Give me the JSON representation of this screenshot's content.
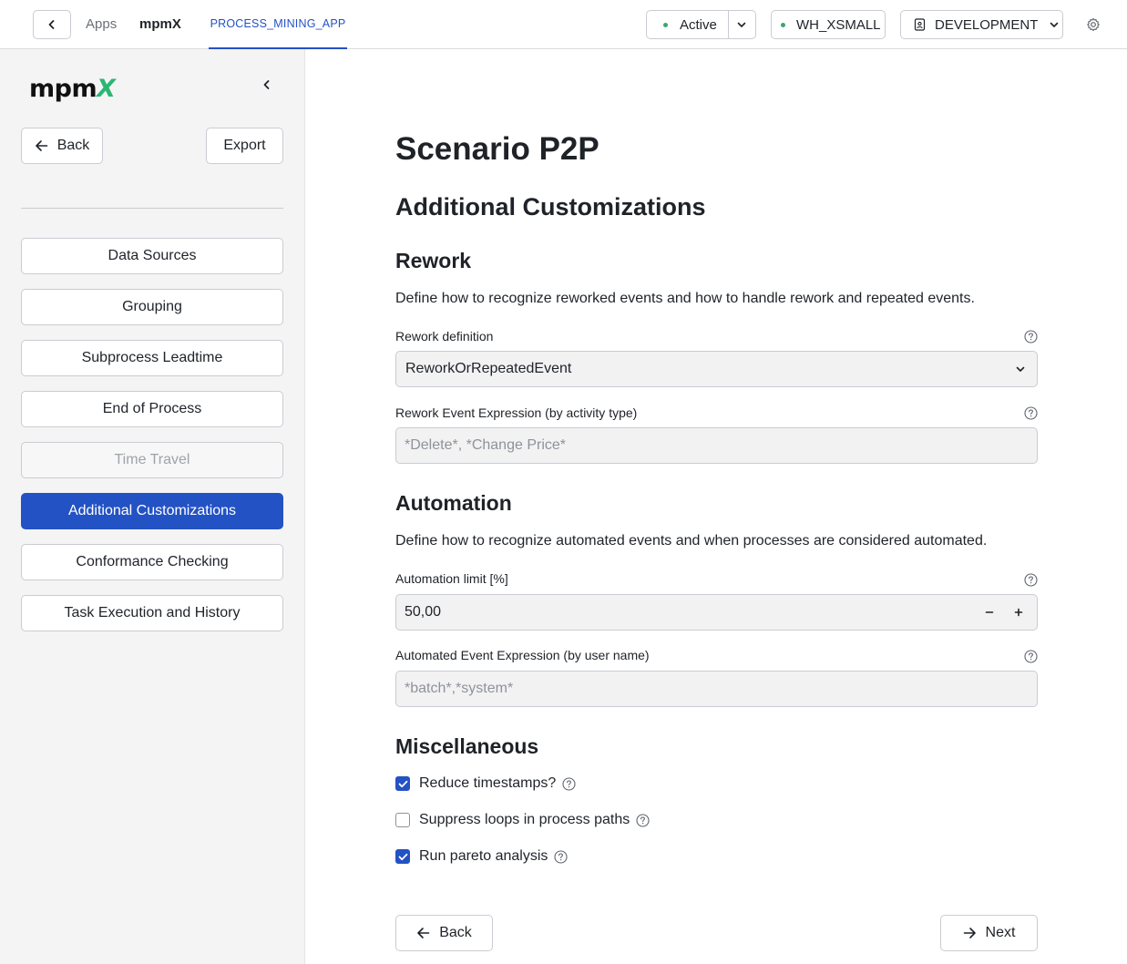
{
  "topbar": {
    "breadcrumb": [
      "Apps",
      "mpmX"
    ],
    "app_tab": "PROCESS_MINING_APP",
    "status": "Active",
    "warehouse": "WH_XSMALL",
    "environment": "DEVELOPMENT"
  },
  "sidebar": {
    "logo_main": "mpm",
    "logo_accent": "X",
    "back_label": "Back",
    "export_label": "Export",
    "nav": [
      {
        "label": "Data Sources",
        "state": "default"
      },
      {
        "label": "Grouping",
        "state": "default"
      },
      {
        "label": "Subprocess Leadtime",
        "state": "default"
      },
      {
        "label": "End of Process",
        "state": "default"
      },
      {
        "label": "Time Travel",
        "state": "disabled"
      },
      {
        "label": "Additional Customizations",
        "state": "active"
      },
      {
        "label": "Conformance Checking",
        "state": "default"
      },
      {
        "label": "Task Execution and History",
        "state": "default"
      }
    ]
  },
  "main": {
    "title": "Scenario P2P",
    "subtitle": "Additional Customizations",
    "rework": {
      "heading": "Rework",
      "description": "Define how to recognize reworked events and how to handle rework and repeated events.",
      "definition_label": "Rework definition",
      "definition_value": "ReworkOrRepeatedEvent",
      "expression_label": "Rework Event Expression (by activity type)",
      "expression_placeholder": "*Delete*, *Change Price*"
    },
    "automation": {
      "heading": "Automation",
      "description": "Define how to recognize automated events and when processes are considered automated.",
      "limit_label": "Automation limit [%]",
      "limit_value": "50,00",
      "expression_label": "Automated Event Expression (by user name)",
      "expression_placeholder": "*batch*,*system*"
    },
    "misc": {
      "heading": "Miscellaneous",
      "options": [
        {
          "label": "Reduce timestamps?",
          "checked": true
        },
        {
          "label": "Suppress loops in process paths",
          "checked": false
        },
        {
          "label": "Run pareto analysis",
          "checked": true
        }
      ]
    },
    "footer": {
      "back_label": "Back",
      "next_label": "Next"
    }
  },
  "colors": {
    "accent": "#2352c4",
    "status_dot": "#3fa56b",
    "logo_accent": "#2bb673"
  }
}
